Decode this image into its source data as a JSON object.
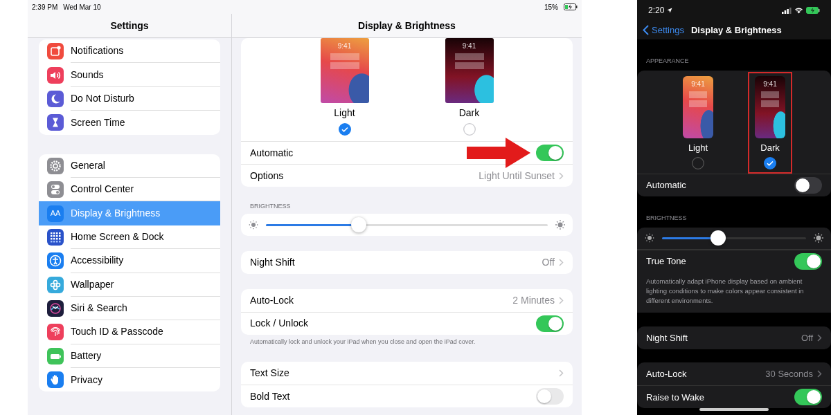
{
  "ipad": {
    "status_bar": {
      "time": "2:39 PM",
      "date": "Wed Mar 10",
      "battery": "15%"
    },
    "sidebar": {
      "title": "Settings",
      "groups": [
        {
          "items": [
            {
              "label": "Notifications",
              "color": "#f04b3e",
              "selected": false
            },
            {
              "label": "Sounds",
              "color": "#ee3f5c",
              "selected": false
            },
            {
              "label": "Do Not Disturb",
              "color": "#5b5bd6",
              "selected": false
            },
            {
              "label": "Screen Time",
              "color": "#5b5bd6",
              "selected": false
            }
          ]
        },
        {
          "items": [
            {
              "label": "General",
              "color": "#8e8e93",
              "selected": false
            },
            {
              "label": "Control Center",
              "color": "#8e8e93",
              "selected": false
            },
            {
              "label": "Display & Brightness",
              "color": "#1a7ef0",
              "selected": true,
              "icon_text": "AA"
            },
            {
              "label": "Home Screen & Dock",
              "color": "#2a52c9",
              "selected": false
            },
            {
              "label": "Accessibility",
              "color": "#1a7ef0",
              "selected": false
            },
            {
              "label": "Wallpaper",
              "color": "#36aadc",
              "selected": false
            },
            {
              "label": "Siri & Search",
              "color": "#1e1e3c",
              "selected": false
            },
            {
              "label": "Touch ID & Passcode",
              "color": "#ee3f5c",
              "selected": false
            },
            {
              "label": "Battery",
              "color": "#3fc35a",
              "selected": false
            },
            {
              "label": "Privacy",
              "color": "#1a7ef0",
              "selected": false
            }
          ]
        }
      ]
    },
    "detail": {
      "title": "Display & Brightness",
      "sections": [
        {
          "kind": "appearance",
          "options": [
            {
              "kind": "light",
              "label": "Light",
              "time": "9:41",
              "selected": true
            },
            {
              "kind": "dark",
              "label": "Dark",
              "time": "9:41",
              "selected": false
            }
          ],
          "rows": [
            {
              "kind": "toggle",
              "label": "Automatic",
              "on": true,
              "annotated": true
            },
            {
              "kind": "value",
              "label": "Options",
              "value": "Light Until Sunset"
            }
          ]
        },
        {
          "kind": "slider",
          "header": "BRIGHTNESS",
          "level": 0.33
        },
        {
          "kind": "list",
          "rows": [
            {
              "kind": "value",
              "label": "Night Shift",
              "value": "Off"
            }
          ]
        },
        {
          "kind": "list",
          "rows": [
            {
              "kind": "value",
              "label": "Auto-Lock",
              "value": "2 Minutes"
            },
            {
              "kind": "toggle",
              "label": "Lock / Unlock",
              "on": true
            }
          ],
          "footer": "Automatically lock and unlock your iPad when you close and open the iPad cover."
        },
        {
          "kind": "list",
          "rows": [
            {
              "kind": "link",
              "label": "Text Size"
            },
            {
              "kind": "toggle",
              "label": "Bold Text",
              "on": false
            }
          ]
        }
      ]
    }
  },
  "iphone": {
    "status_bar": {
      "time": "2:20"
    },
    "nav": {
      "back": "Settings",
      "title": "Display & Brightness"
    },
    "sections": [
      {
        "kind": "appearance",
        "header": "APPEARANCE",
        "options": [
          {
            "kind": "light",
            "label": "Light",
            "time": "9:41",
            "selected": false
          },
          {
            "kind": "dark",
            "label": "Dark",
            "time": "9:41",
            "selected": true,
            "highlighted": true
          }
        ],
        "rows": [
          {
            "kind": "toggle",
            "label": "Automatic",
            "on": false
          }
        ]
      },
      {
        "kind": "slider",
        "header": "BRIGHTNESS",
        "level": 0.39,
        "rows": [
          {
            "kind": "toggle",
            "label": "True Tone",
            "on": true
          }
        ],
        "footer": "Automatically adapt iPhone display based on ambient lighting conditions to make colors appear consistent in different environments."
      },
      {
        "kind": "list",
        "rows": [
          {
            "kind": "value",
            "label": "Night Shift",
            "value": "Off"
          }
        ]
      },
      {
        "kind": "list",
        "rows": [
          {
            "kind": "value",
            "label": "Auto-Lock",
            "value": "30 Seconds"
          },
          {
            "kind": "toggle",
            "label": "Raise to Wake",
            "on": true
          }
        ]
      }
    ]
  }
}
